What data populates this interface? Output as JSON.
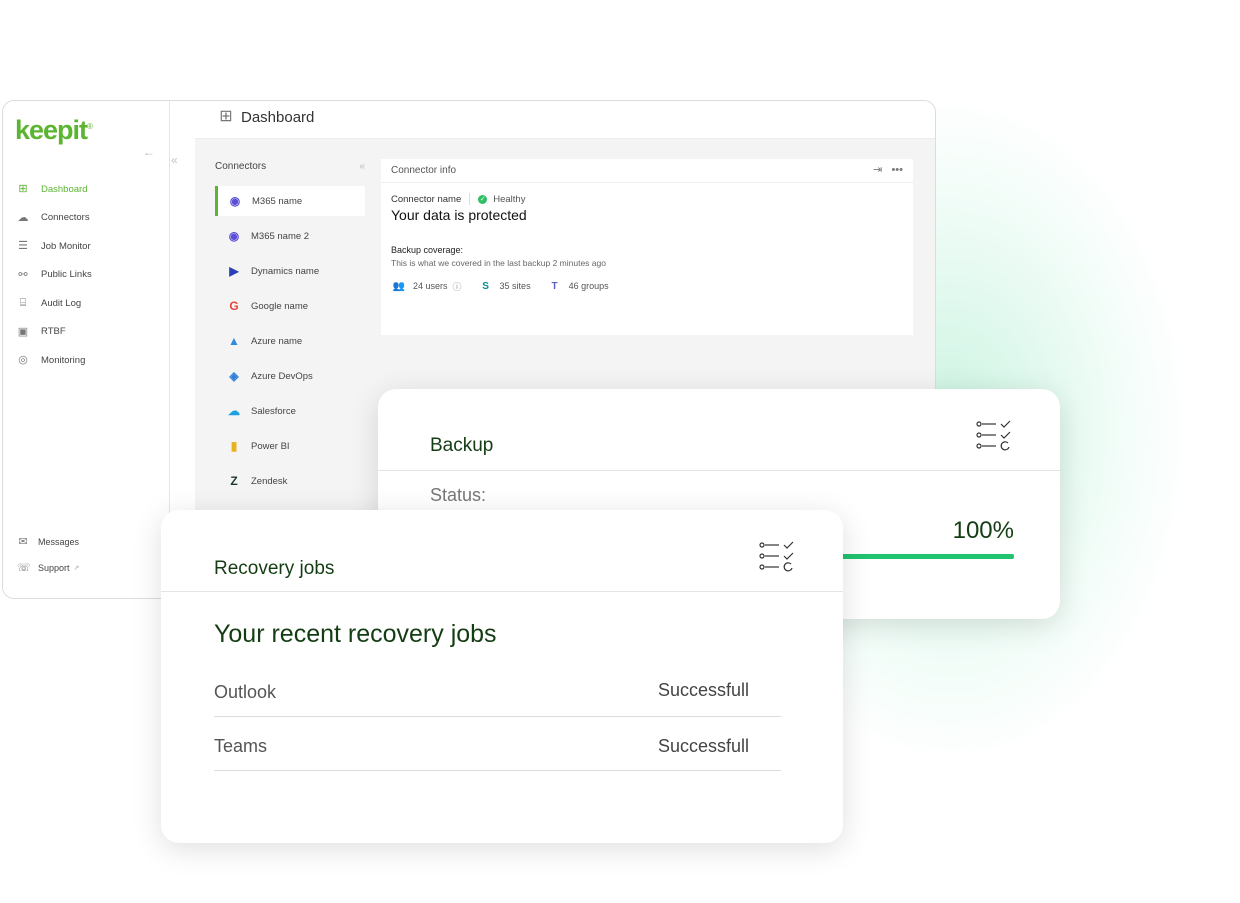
{
  "brand": {
    "logo_text": "keepit",
    "accent": "#5cb530",
    "progress_color": "#20c36f"
  },
  "sidebar": {
    "items": [
      {
        "label": "Dashboard",
        "icon": "grid-icon",
        "glyph": "⊞",
        "active": true
      },
      {
        "label": "Connectors",
        "icon": "cloud-icon",
        "glyph": "☁"
      },
      {
        "label": "Job Monitor",
        "icon": "list-icon",
        "glyph": "☰"
      },
      {
        "label": "Public Links",
        "icon": "share-icon",
        "glyph": "⚯"
      },
      {
        "label": "Audit Log",
        "icon": "log-icon",
        "glyph": "⌸"
      },
      {
        "label": "RTBF",
        "icon": "id-icon",
        "glyph": "▣"
      },
      {
        "label": "Monitoring",
        "icon": "radar-icon",
        "glyph": "◎"
      }
    ],
    "bottom": [
      {
        "label": "Messages",
        "icon": "mail-icon",
        "glyph": "✉"
      },
      {
        "label": "Support",
        "icon": "support-icon",
        "glyph": "☏",
        "suffix": "↗"
      }
    ]
  },
  "header": {
    "title": "Dashboard",
    "icon": "dashboard-icon"
  },
  "connectors": {
    "heading": "Connectors",
    "items": [
      {
        "label": "M365 name",
        "icon": "m365-icon",
        "glyph": "◉",
        "color": "#5b4fd6",
        "active": true
      },
      {
        "label": "M365 name 2",
        "icon": "m365-icon",
        "glyph": "◉",
        "color": "#5b4fd6"
      },
      {
        "label": "Dynamics name",
        "icon": "dynamics-icon",
        "glyph": "▶",
        "color": "#2a3fb8"
      },
      {
        "label": "Google name",
        "icon": "google-icon",
        "glyph": "G",
        "color": "#e8453c"
      },
      {
        "label": "Azure name",
        "icon": "azure-icon",
        "glyph": "▲",
        "color": "#2f8ad8"
      },
      {
        "label": "Azure DevOps",
        "icon": "azure-devops-icon",
        "glyph": "◈",
        "color": "#2f7fd6"
      },
      {
        "label": "Salesforce",
        "icon": "salesforce-icon",
        "glyph": "☁",
        "color": "#1ea0e0"
      },
      {
        "label": "Power BI",
        "icon": "powerbi-icon",
        "glyph": "▮",
        "color": "#e8b21e"
      },
      {
        "label": "Zendesk",
        "icon": "zendesk-icon",
        "glyph": "Z",
        "color": "#1f3a2e"
      }
    ]
  },
  "connector_info": {
    "heading": "Connector info",
    "name": "Connector name",
    "health": "Healthy",
    "message": "Your data is protected",
    "coverage_title": "Backup coverage:",
    "coverage_sub": "This is what we covered in the last backup 2 minutes ago",
    "stats": [
      {
        "label": "24 users",
        "icon": "users-icon",
        "glyph": "👥",
        "color": "#777"
      },
      {
        "label": "35 sites",
        "icon": "sharepoint-icon",
        "glyph": "S",
        "color": "#0b8c8c"
      },
      {
        "label": "46 groups",
        "icon": "teams-icon",
        "glyph": "T",
        "color": "#5b5fc7"
      }
    ]
  },
  "backup_card": {
    "title": "Backup",
    "status_label": "Status:",
    "percent": "100%",
    "progress": 1.0
  },
  "recovery_card": {
    "title": "Recovery jobs",
    "heading": "Your recent recovery jobs",
    "jobs": [
      {
        "name": "Outlook",
        "status": "Successfull"
      },
      {
        "name": "Teams",
        "status": "Successfull"
      }
    ]
  }
}
